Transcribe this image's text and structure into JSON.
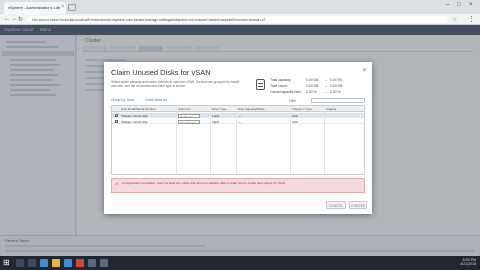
{
  "browser": {
    "tab_title": "vSphere - Administrator's Lab",
    "url_secure": "Not secure",
    "url": "https://vcsa.lab.local/ui/#?extensionId=vsphere.core.cluster.manage.settings&objectId=urn:vmomi:ClusterComputeResource:domain-c7",
    "icons": [
      "back-icon",
      "forward-icon",
      "reload-icon",
      "star-icon",
      "menu-icon"
    ]
  },
  "vsphere": {
    "logo": "vSphere Client",
    "menu": "Menu",
    "object_title": "Cluster"
  },
  "dialog": {
    "title": "Claim Unused Disks for vSAN",
    "description": "Select which capacity and cache devices to claim for vSAN. Devices are grouped by model and size, and the recommended claim type is shown.",
    "capacity": [
      {
        "label": "Total capacity:",
        "before": "0.00 GB",
        "arrow": "→",
        "after": "0.00 TB"
      },
      {
        "label": "Total cache:",
        "before": "0.00 GB",
        "arrow": "→",
        "after": "0.00 GB"
      },
      {
        "label": "Cache/capacity ratio:",
        "before": "0.00 %",
        "arrow": "→",
        "after": "0.00 %"
      }
    ],
    "toolbar": {
      "group_by": "Group by: Host",
      "actions": "Claim disks as",
      "filter_label": "Filter",
      "filter_placeholder": ""
    },
    "table": {
      "headers": [
        "Disk Model/Serial Number",
        "Claim For",
        "Drive Type",
        "Disk Capacity/Disks",
        "Transport Type",
        "Adapter"
      ],
      "rows": [
        {
          "name": "VMware Virtual disk",
          "claim": "Cache tier",
          "drive": "Flash",
          "capacity": "—",
          "transport": "SAS",
          "adapter": ""
        },
        {
          "name": "VMware Virtual disk",
          "claim": "Capacity tier",
          "drive": "Flash",
          "capacity": "—",
          "transport": "SAS",
          "adapter": ""
        }
      ]
    },
    "warning": "Configuration incomplete. Claim at least one cache disk and one capacity disk on each host to create disk groups for vSAN.",
    "cancel_label": "CANCEL",
    "ok_label": "CREATE"
  },
  "tasks": {
    "title": "Recent Tasks"
  },
  "taskbar": {
    "time": "6:03 PM",
    "date": "4/21/2018"
  },
  "colors": {
    "warning_bg": "#f5dada",
    "selected_row": "#d6e6f4",
    "link": "#3a78b5",
    "header": "#2c3e50"
  }
}
